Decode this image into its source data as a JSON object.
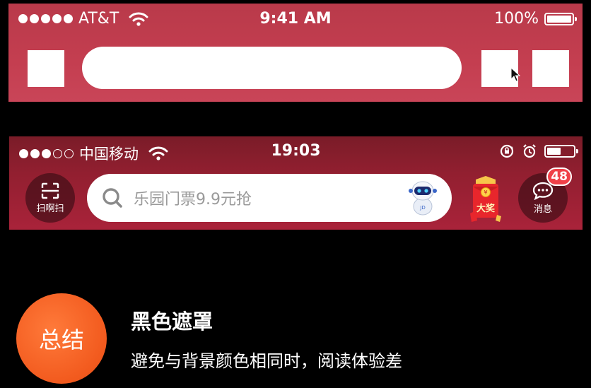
{
  "mock1": {
    "status_bar": {
      "signal_dots": 5,
      "carrier": "AT&T",
      "time": "9:41 AM",
      "battery_text": "100%",
      "battery_level": 1.0
    },
    "colors": {
      "bar_gradient_top": "#b93a4a",
      "bar_gradient_bottom": "#c94558"
    }
  },
  "mock2": {
    "status_bar": {
      "signal_dots_filled": 3,
      "signal_dots_empty": 2,
      "carrier": "中国移动",
      "time": "19:03",
      "battery_level": 0.5
    },
    "scan_button": {
      "label": "扫啊扫",
      "icon": "scan-icon"
    },
    "search": {
      "placeholder": "乐园门票9.9元抢",
      "icon": "search-icon",
      "mascot_icon": "jd-robot-icon"
    },
    "promo": {
      "label": "大奖",
      "icon": "red-envelope-icon"
    },
    "message_button": {
      "label": "消息",
      "badge": "48",
      "icon": "chat-bubble-icon"
    },
    "colors": {
      "bar_gradient_top": "#7a1c28",
      "bar_gradient_bottom": "#a9233a",
      "badge": "#f04048"
    }
  },
  "summary": {
    "badge_label": "总结",
    "title": "黑色遮罩",
    "description": "避免与背景颜色相同时，阅读体验差",
    "colors": {
      "badge": "#f25a1e"
    }
  }
}
